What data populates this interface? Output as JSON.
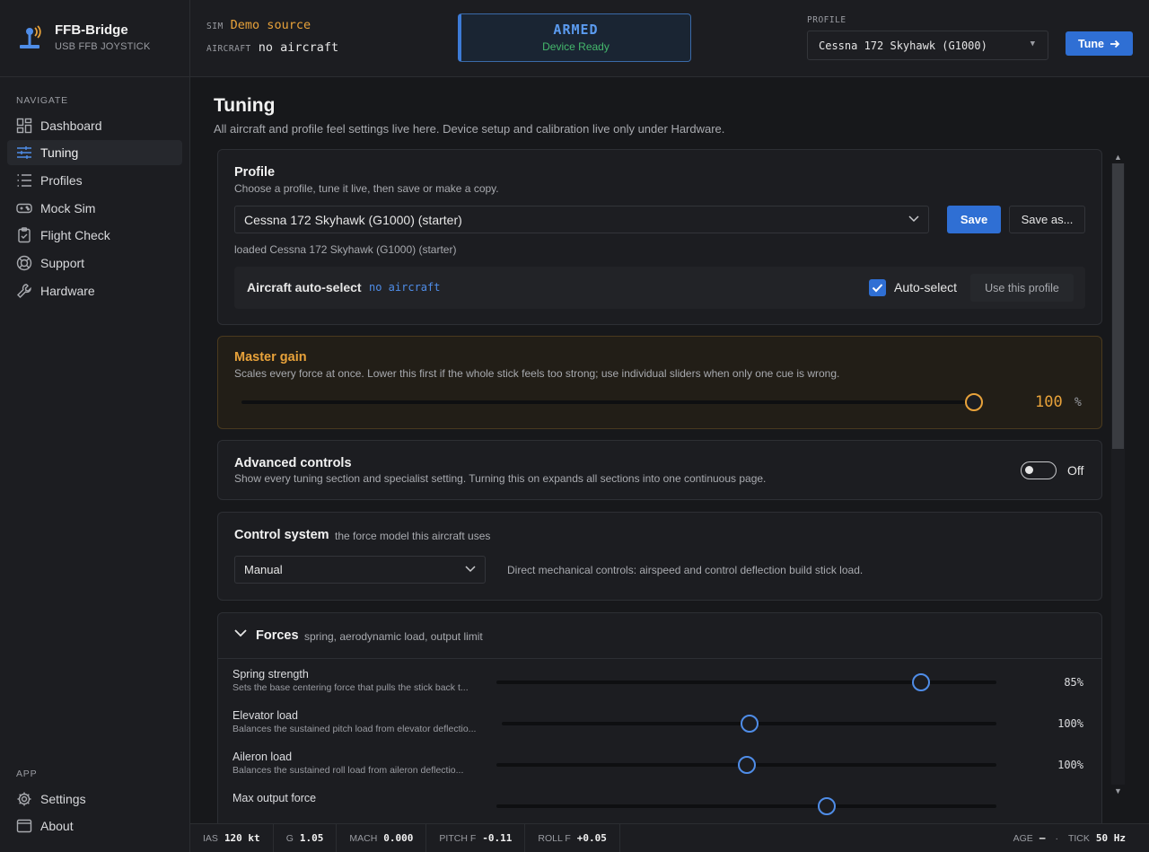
{
  "brand": {
    "title": "FFB-Bridge",
    "subtitle": "USB FFB JOYSTICK"
  },
  "header": {
    "sim_tag": "SIM",
    "sim_value": "Demo source",
    "aircraft_tag": "AIRCRAFT",
    "aircraft_value": "no aircraft",
    "status_title": "ARMED",
    "status_sub": "Device Ready",
    "profile_tag": "PROFILE",
    "profile_value": "Cessna 172 Skyhawk (G1000)",
    "tune_label": "Tune"
  },
  "sidebar": {
    "navigate_label": "NAVIGATE",
    "items": [
      {
        "label": "Dashboard",
        "icon": "dashboard-icon"
      },
      {
        "label": "Tuning",
        "icon": "sliders-icon",
        "active": true
      },
      {
        "label": "Profiles",
        "icon": "list-icon"
      },
      {
        "label": "Mock Sim",
        "icon": "gamepad-icon"
      },
      {
        "label": "Flight Check",
        "icon": "clipboard-check-icon"
      },
      {
        "label": "Support",
        "icon": "lifebuoy-icon"
      },
      {
        "label": "Hardware",
        "icon": "wrench-icon"
      }
    ],
    "app_label": "APP",
    "app_items": [
      {
        "label": "Settings",
        "icon": "gear-icon"
      },
      {
        "label": "About",
        "icon": "window-icon"
      }
    ]
  },
  "page": {
    "title": "Tuning",
    "subtitle": "All aircraft and profile feel settings live here. Device setup and calibration live only under Hardware."
  },
  "profile_card": {
    "title": "Profile",
    "subtitle": "Choose a profile, tune it live, then save or make a copy.",
    "selected": "Cessna 172 Skyhawk (G1000) (starter)",
    "save_label": "Save",
    "save_as_label": "Save as...",
    "loaded_text": "loaded Cessna 172 Skyhawk (G1000) (starter)",
    "autoselect_title": "Aircraft auto-select",
    "autoselect_aircraft": "no aircraft",
    "autoselect_checkbox_label": "Auto-select",
    "autoselect_checked": true,
    "use_profile_label": "Use this profile"
  },
  "master_gain": {
    "title": "Master gain",
    "subtitle": "Scales every force at once. Lower this first if the whole stick feels too strong; use individual sliders when only one cue is wrong.",
    "value": "100",
    "unit": "%",
    "fraction": 1.0,
    "accent": "#e8a23a"
  },
  "advanced": {
    "title": "Advanced controls",
    "subtitle": "Show every tuning section and specialist setting. Turning this on expands all sections into one continuous page.",
    "toggle_label": "Off",
    "enabled": false
  },
  "control_system": {
    "title": "Control system",
    "hint": "the force model this aircraft uses",
    "selected": "Manual",
    "description": "Direct mechanical controls: airspeed and control deflection build stick load."
  },
  "forces": {
    "title": "Forces",
    "hint": "spring, aerodynamic load, output limit",
    "rows": [
      {
        "label": "Spring strength",
        "desc": "Sets the base centering force that pulls the stick back t...",
        "value": "85%",
        "fraction": 0.85
      },
      {
        "label": "Elevator load",
        "desc": "Balances the sustained pitch load from elevator deflectio...",
        "value": "100%",
        "fraction": 0.5
      },
      {
        "label": "Aileron load",
        "desc": "Balances the sustained roll load from aileron deflectio...",
        "value": "100%",
        "fraction": 0.5
      },
      {
        "label": "Max output force",
        "desc": "",
        "value": "",
        "fraction": 0.66
      }
    ]
  },
  "statusbar": {
    "items": [
      {
        "label": "IAS",
        "value": "120 kt"
      },
      {
        "label": "G",
        "value": "1.05"
      },
      {
        "label": "MACH",
        "value": "0.000"
      },
      {
        "label": "PITCH F",
        "value": "-0.11"
      },
      {
        "label": "ROLL F",
        "value": "+0.05"
      }
    ],
    "age_label": "AGE",
    "age_value": "—",
    "dot": "·",
    "tick_label": "TICK",
    "tick_value": "50 Hz"
  },
  "colors": {
    "accent_blue": "#2f6fd4",
    "armed_blue": "#5b9bef",
    "ready_green": "#44b86c",
    "gain_orange": "#e8a23a"
  }
}
